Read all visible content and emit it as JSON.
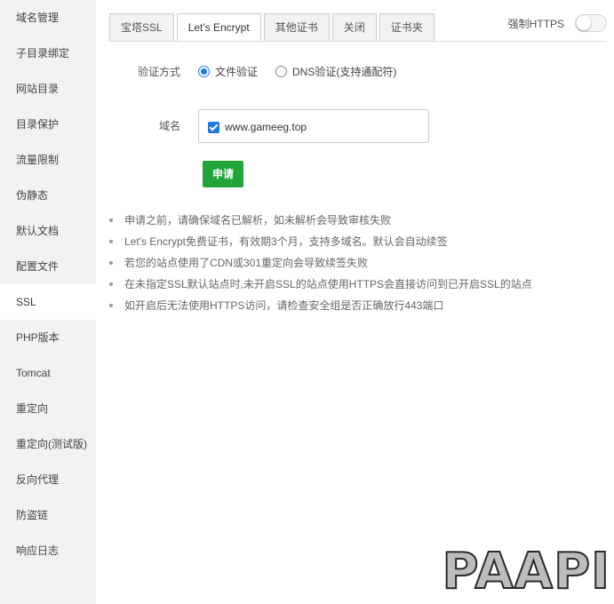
{
  "sidebar": {
    "items": [
      {
        "label": "域名管理"
      },
      {
        "label": "子目录绑定"
      },
      {
        "label": "网站目录"
      },
      {
        "label": "目录保护"
      },
      {
        "label": "流量限制"
      },
      {
        "label": "伪静态"
      },
      {
        "label": "默认文档"
      },
      {
        "label": "配置文件"
      },
      {
        "label": "SSL",
        "active": true
      },
      {
        "label": "PHP版本"
      },
      {
        "label": "Tomcat"
      },
      {
        "label": "重定向"
      },
      {
        "label": "重定向(测试版)"
      },
      {
        "label": "反向代理"
      },
      {
        "label": "防盗链"
      },
      {
        "label": "响应日志"
      }
    ]
  },
  "tabs": [
    {
      "label": "宝塔SSL"
    },
    {
      "label": "Let's Encrypt",
      "active": true
    },
    {
      "label": "其他证书"
    },
    {
      "label": "关闭"
    },
    {
      "label": "证书夹"
    }
  ],
  "force_https": {
    "label": "强制HTTPS",
    "enabled": false
  },
  "verify": {
    "label": "验证方式",
    "options": [
      {
        "label": "文件验证",
        "checked": true
      },
      {
        "label": "DNS验证(支持通配符)",
        "checked": false
      }
    ]
  },
  "domain": {
    "label": "域名",
    "entries": [
      {
        "name": "www.gameeg.top",
        "checked": true
      }
    ]
  },
  "apply_label": "申请",
  "tips": [
    "申请之前，请确保域名已解析，如未解析会导致审核失败",
    "Let's Encrypt免费证书，有效期3个月，支持多域名。默认会自动续签",
    "若您的站点使用了CDN或301重定向会导致续签失败",
    "在未指定SSL默认站点时,未开启SSL的站点使用HTTPS会直接访问到已开启SSL的站点",
    "如开启后无法使用HTTPS访问，请检查安全组是否正确放行443端口"
  ],
  "watermark": "PAAPI",
  "colors": {
    "accent": "#20a53a",
    "radio_checked": "#1e78e6",
    "sidebar_bg": "#f2f2f2"
  }
}
